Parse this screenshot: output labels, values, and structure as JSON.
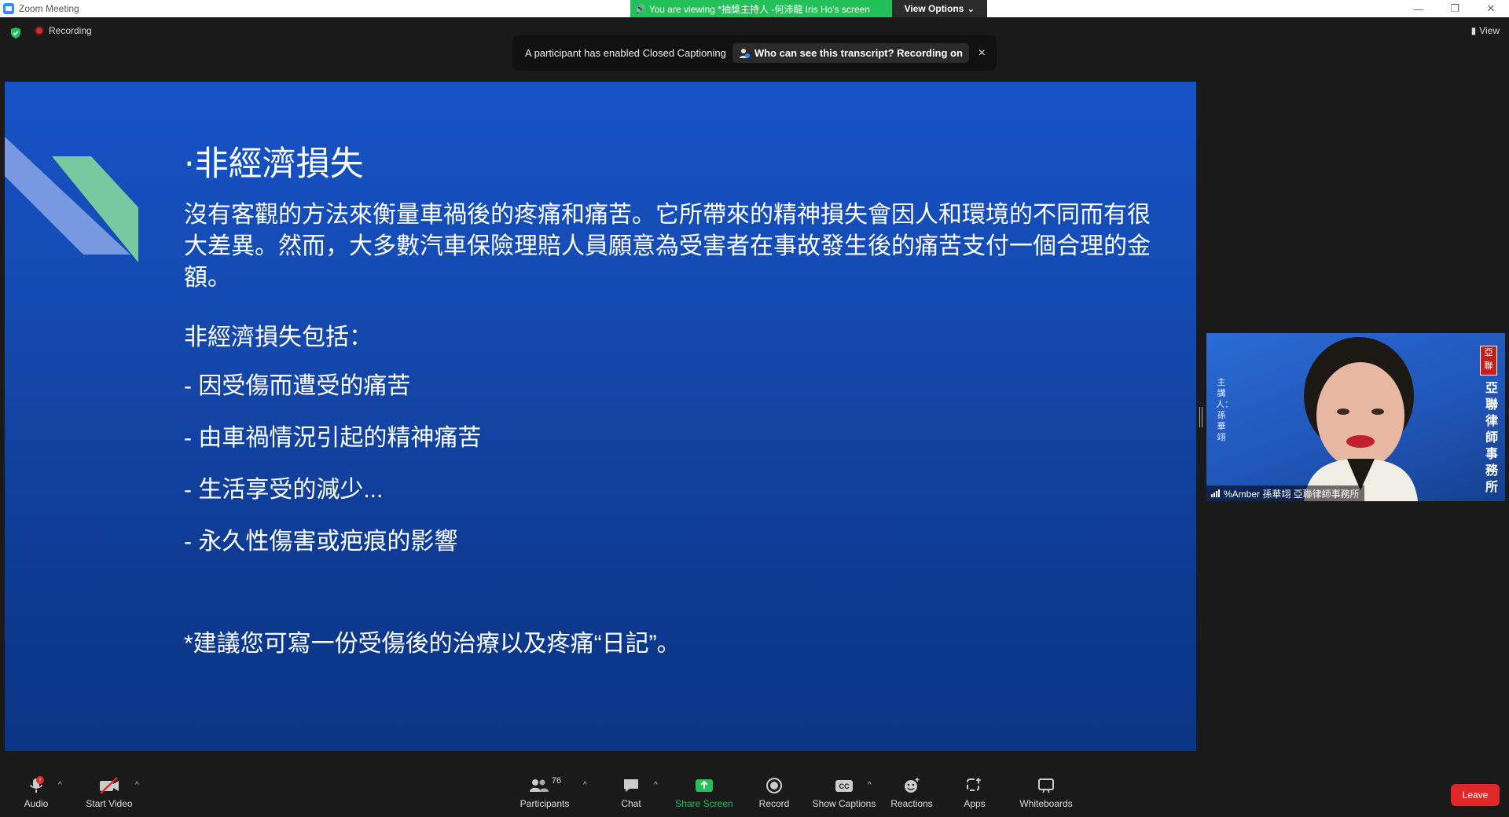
{
  "window": {
    "title": "Zoom Meeting",
    "viewing_banner": "You are viewing *抽獎主持人 -何沛龍 Iris Ho's screen",
    "view_options": "View Options",
    "controls": [
      "—",
      "❐",
      "✕"
    ]
  },
  "status": {
    "recording": "Recording",
    "view": "View"
  },
  "cc_notice": {
    "text": "A participant has enabled Closed Captioning",
    "who": "Who can see this transcript? Recording on",
    "close": "×"
  },
  "slide": {
    "title": "·非經濟損失",
    "paragraph": "沒有客觀的方法來衡量車禍後的疼痛和痛苦。它所帶來的精神損失會因人和環境的不同而有很大差異。然而，大多數汽車保險理賠人員願意為受害者在事故發生後的痛苦支付一個合理的金額。",
    "heading": "非經濟損失包括：",
    "bullets": [
      "- 因受傷而遭受的痛苦",
      "- 由車禍情況引起的精神痛苦",
      "- 生活享受的減少...",
      "- 永久性傷害或疤痕的影響"
    ],
    "note": "*建議您可寫一份受傷後的治療以及疼痛“日記”。"
  },
  "video": {
    "side_text": "主講人：孫華翊",
    "right_text": "亞聯律師事務所",
    "seal": "亞聯",
    "name": "%Amber 孫華翊 亞聯律師事務所"
  },
  "toolbar": {
    "audio": "Audio",
    "audio_badge": "!",
    "start_video": "Start Video",
    "participants": "Participants",
    "participants_count": "76",
    "chat": "Chat",
    "share_screen": "Share Screen",
    "record": "Record",
    "show_captions": "Show Captions",
    "reactions": "Reactions",
    "apps": "Apps",
    "whiteboards": "Whiteboards",
    "leave": "Leave",
    "caret": "^"
  },
  "colors": {
    "share_green": "#23c05a",
    "leave_red": "#e02828",
    "slide_blue": "#1653c7"
  }
}
